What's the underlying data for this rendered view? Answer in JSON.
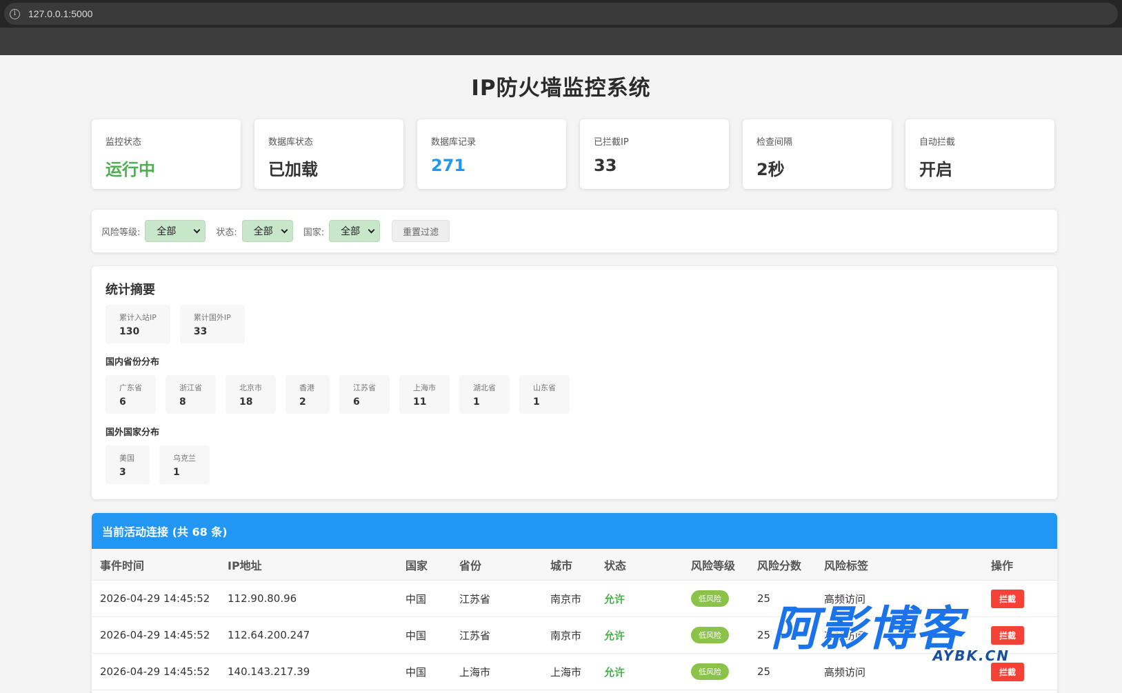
{
  "browser": {
    "url": "127.0.0.1:5000"
  },
  "page": {
    "title": "IP防火墙监控系统"
  },
  "cards": [
    {
      "label": "监控状态",
      "value": "运行中"
    },
    {
      "label": "数据库状态",
      "value": "已加载"
    },
    {
      "label": "数据库记录",
      "value": "271"
    },
    {
      "label": "已拦截IP",
      "value": "33"
    },
    {
      "label": "检查间隔",
      "value": "2秒"
    },
    {
      "label": "自动拦截",
      "value": "开启"
    }
  ],
  "filters": {
    "risk_label": "风险等级:",
    "risk_value": "全部",
    "status_label": "状态:",
    "status_value": "全部",
    "country_label": "国家:",
    "country_value": "全部",
    "reset_label": "重置过滤"
  },
  "stats": {
    "title": "统计摘要",
    "totals": [
      {
        "label": "累计入站IP",
        "value": "130"
      },
      {
        "label": "累计国外IP",
        "value": "33"
      }
    ],
    "province_title": "国内省份分布",
    "provinces": [
      {
        "label": "广东省",
        "value": "6"
      },
      {
        "label": "浙江省",
        "value": "8"
      },
      {
        "label": "北京市",
        "value": "18"
      },
      {
        "label": "香港",
        "value": "2"
      },
      {
        "label": "江苏省",
        "value": "6"
      },
      {
        "label": "上海市",
        "value": "11"
      },
      {
        "label": "湖北省",
        "value": "1"
      },
      {
        "label": "山东省",
        "value": "1"
      }
    ],
    "country_title": "国外国家分布",
    "countries": [
      {
        "label": "美国",
        "value": "3"
      },
      {
        "label": "乌克兰",
        "value": "1"
      }
    ]
  },
  "connections": {
    "title": "当前活动连接 (共 68 条)",
    "headers": [
      "事件时间",
      "IP地址",
      "国家",
      "省份",
      "城市",
      "状态",
      "风险等级",
      "风险分数",
      "风险标签",
      "操作"
    ],
    "rows": [
      {
        "time": "2026-04-29 14:45:52",
        "ip": "112.90.80.96",
        "country": "中国",
        "province": "江苏省",
        "city": "南京市",
        "status": "允许",
        "risk": "低风险",
        "score": "25",
        "tag": "高频访问",
        "action": "拦截"
      },
      {
        "time": "2026-04-29 14:45:52",
        "ip": "112.64.200.247",
        "country": "中国",
        "province": "江苏省",
        "city": "南京市",
        "status": "允许",
        "risk": "低风险",
        "score": "25",
        "tag": "高频访问",
        "action": "拦截"
      },
      {
        "time": "2026-04-29 14:45:52",
        "ip": "140.143.217.39",
        "country": "中国",
        "province": "上海市",
        "city": "上海市",
        "status": "允许",
        "risk": "低风险",
        "score": "25",
        "tag": "高频访问",
        "action": "拦截"
      }
    ]
  },
  "watermark": {
    "main": "阿影博客",
    "sub": "AYBK.CN"
  }
}
